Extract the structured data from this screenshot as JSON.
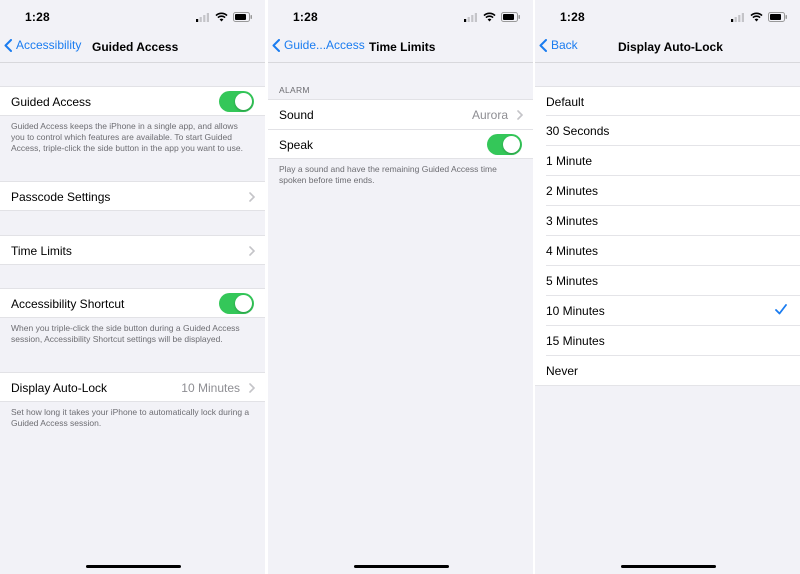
{
  "status_bar": {
    "time": "1:28"
  },
  "screen1": {
    "back_label": "Accessibility",
    "title": "Guided Access",
    "guided_access": {
      "label": "Guided Access",
      "enabled": true
    },
    "guided_access_footer": "Guided Access keeps the iPhone in a single app, and allows you to control which features are available. To start Guided Access, triple-click the side button in the app you want to use.",
    "passcode_settings": {
      "label": "Passcode Settings"
    },
    "time_limits": {
      "label": "Time Limits"
    },
    "accessibility_shortcut": {
      "label": "Accessibility Shortcut",
      "enabled": true
    },
    "shortcut_footer": "When you triple-click the side button during a Guided Access session, Accessibility Shortcut settings will be displayed.",
    "display_auto_lock": {
      "label": "Display Auto-Lock",
      "value": "10 Minutes"
    },
    "auto_lock_footer": "Set how long it takes your iPhone to automatically lock during a Guided Access session."
  },
  "screen2": {
    "back_label": "Guide...Access",
    "title": "Time Limits",
    "section_header": "ALARM",
    "sound": {
      "label": "Sound",
      "value": "Aurora"
    },
    "speak": {
      "label": "Speak",
      "enabled": true
    },
    "footer": "Play a sound and have the remaining Guided Access time spoken before time ends."
  },
  "screen3": {
    "back_label": "Back",
    "title": "Display Auto-Lock",
    "options": [
      "Default",
      "30 Seconds",
      "1 Minute",
      "2 Minutes",
      "3 Minutes",
      "4 Minutes",
      "5 Minutes",
      "10 Minutes",
      "15 Minutes",
      "Never"
    ],
    "selected": "10 Minutes"
  },
  "colors": {
    "accent": "#1a7cf0",
    "toggle_on": "#34c759",
    "background": "#f2f2f7",
    "secondary_text": "#6d6d72"
  },
  "icons": [
    "signal-icon",
    "wifi-icon",
    "battery-icon",
    "back-chevron-icon",
    "chevron-right-icon",
    "checkmark-icon"
  ]
}
